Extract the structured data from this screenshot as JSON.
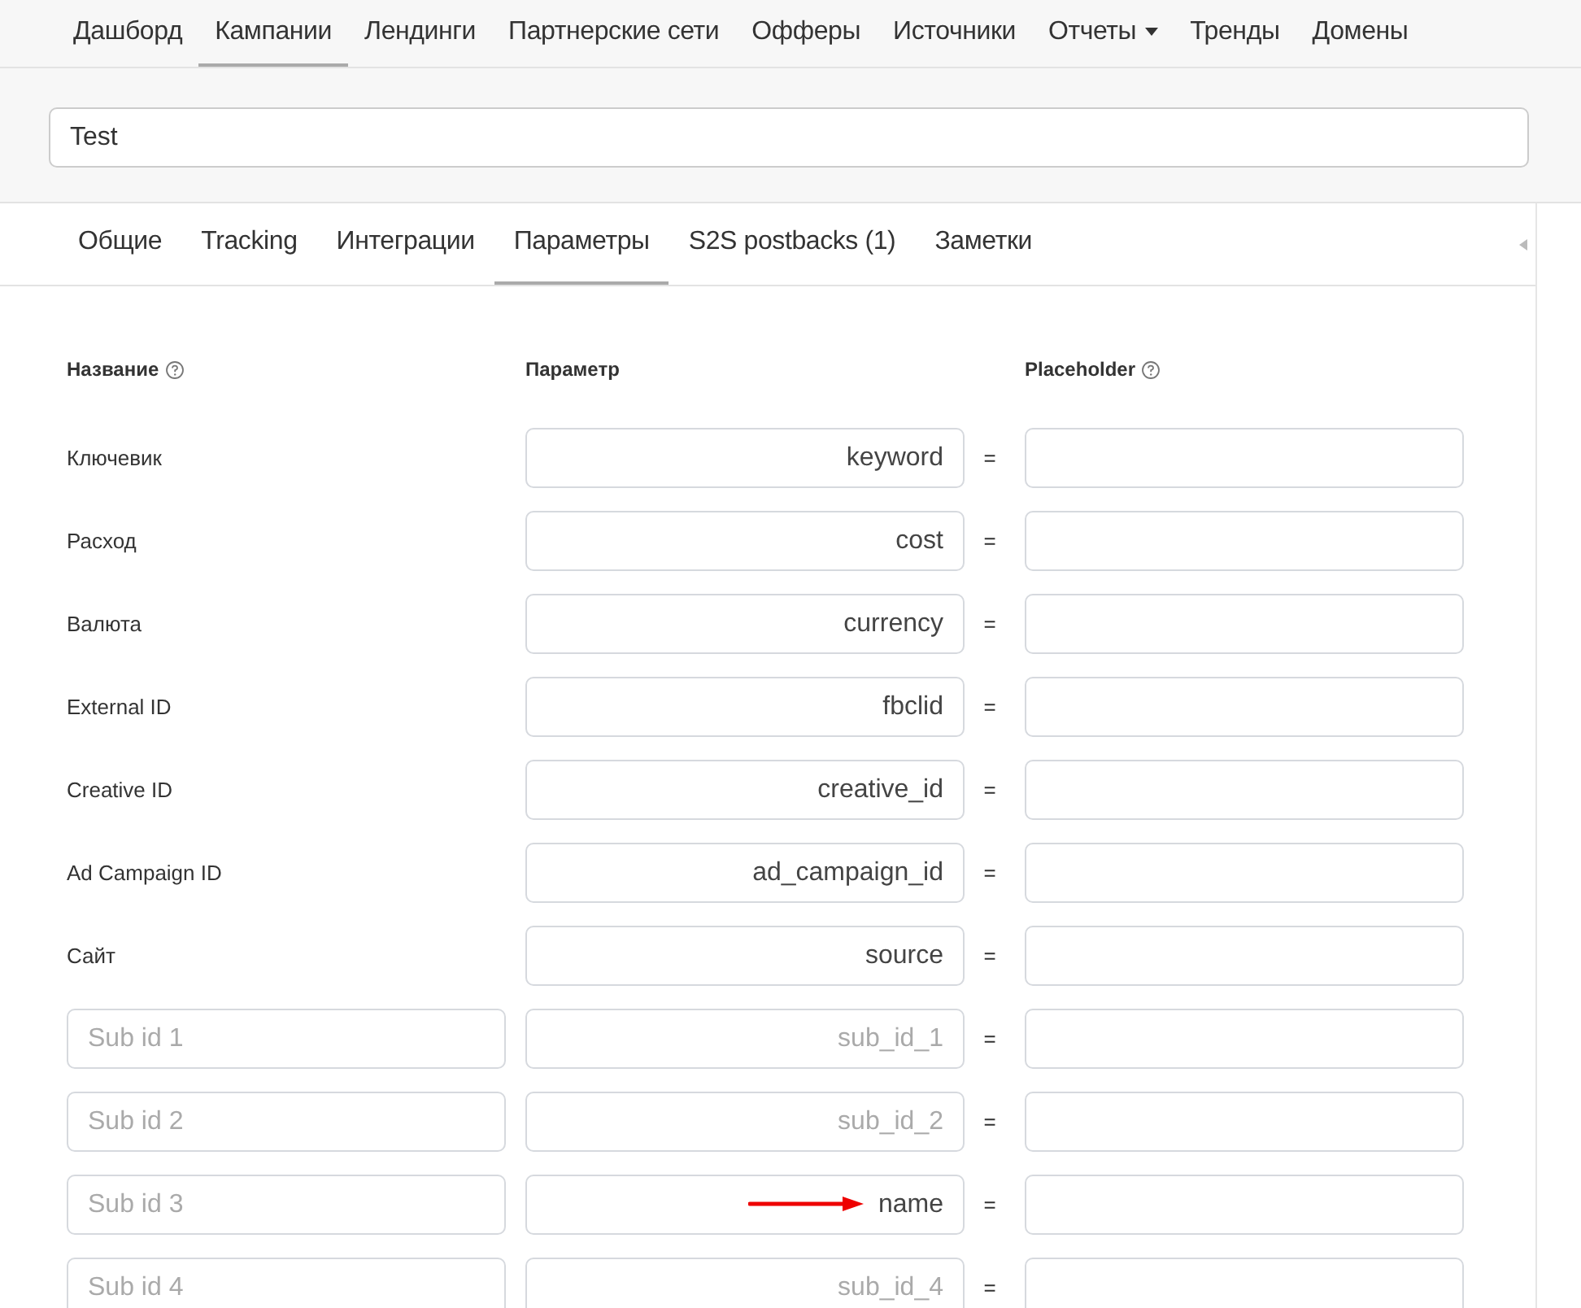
{
  "nav": [
    {
      "label": "Дашборд",
      "selected": false,
      "dropdown": false
    },
    {
      "label": "Кампании",
      "selected": true,
      "dropdown": false
    },
    {
      "label": "Лендинги",
      "selected": false,
      "dropdown": false
    },
    {
      "label": "Партнерские сети",
      "selected": false,
      "dropdown": false
    },
    {
      "label": "Офферы",
      "selected": false,
      "dropdown": false
    },
    {
      "label": "Источники",
      "selected": false,
      "dropdown": false
    },
    {
      "label": "Отчеты",
      "selected": false,
      "dropdown": true
    },
    {
      "label": "Тренды",
      "selected": false,
      "dropdown": false
    },
    {
      "label": "Домены",
      "selected": false,
      "dropdown": false
    }
  ],
  "name_field": {
    "value": "Test"
  },
  "tabs": [
    {
      "label": "Общие",
      "selected": false
    },
    {
      "label": "Tracking",
      "selected": false
    },
    {
      "label": "Интеграции",
      "selected": false
    },
    {
      "label": "Параметры",
      "selected": true
    },
    {
      "label": "S2S postbacks (1)",
      "selected": false
    },
    {
      "label": "Заметки",
      "selected": false
    }
  ],
  "table": {
    "columns": [
      {
        "label": "Название",
        "help": true
      },
      {
        "label": "Параметр",
        "help": false
      },
      {
        "label": "Placeholder",
        "help": true
      }
    ],
    "separator": "=",
    "rows": [
      {
        "kind": "fixed",
        "name": {
          "label": "Ключевик"
        },
        "param": {
          "value": "keyword"
        },
        "placeholder": {}
      },
      {
        "kind": "fixed",
        "name": {
          "label": "Расход"
        },
        "param": {
          "value": "cost"
        },
        "placeholder": {}
      },
      {
        "kind": "fixed",
        "name": {
          "label": "Валюта"
        },
        "param": {
          "value": "currency"
        },
        "placeholder": {}
      },
      {
        "kind": "fixed",
        "name": {
          "label": "External ID"
        },
        "param": {
          "value": "fbclid"
        },
        "placeholder": {}
      },
      {
        "kind": "fixed",
        "name": {
          "label": "Creative ID"
        },
        "param": {
          "value": "creative_id"
        },
        "placeholder": {}
      },
      {
        "kind": "fixed",
        "name": {
          "label": "Ad Campaign ID"
        },
        "param": {
          "value": "ad_campaign_id"
        },
        "placeholder": {}
      },
      {
        "kind": "fixed",
        "name": {
          "label": "Сайт"
        },
        "param": {
          "value": "source"
        },
        "placeholder": {}
      },
      {
        "kind": "custom",
        "name": {
          "placeholder": "Sub id 1"
        },
        "param": {
          "placeholder": "sub_id_1",
          "arrow": false
        },
        "placeholder": {}
      },
      {
        "kind": "custom",
        "name": {
          "placeholder": "Sub id 2"
        },
        "param": {
          "placeholder": "sub_id_2",
          "arrow": false
        },
        "placeholder": {}
      },
      {
        "kind": "custom",
        "name": {
          "placeholder": "Sub id 3"
        },
        "param": {
          "value": "name",
          "arrow": true
        },
        "placeholder": {}
      },
      {
        "kind": "custom",
        "name": {
          "placeholder": "Sub id 4"
        },
        "param": {
          "placeholder": "sub_id_4",
          "arrow": false
        },
        "placeholder": {}
      }
    ]
  }
}
